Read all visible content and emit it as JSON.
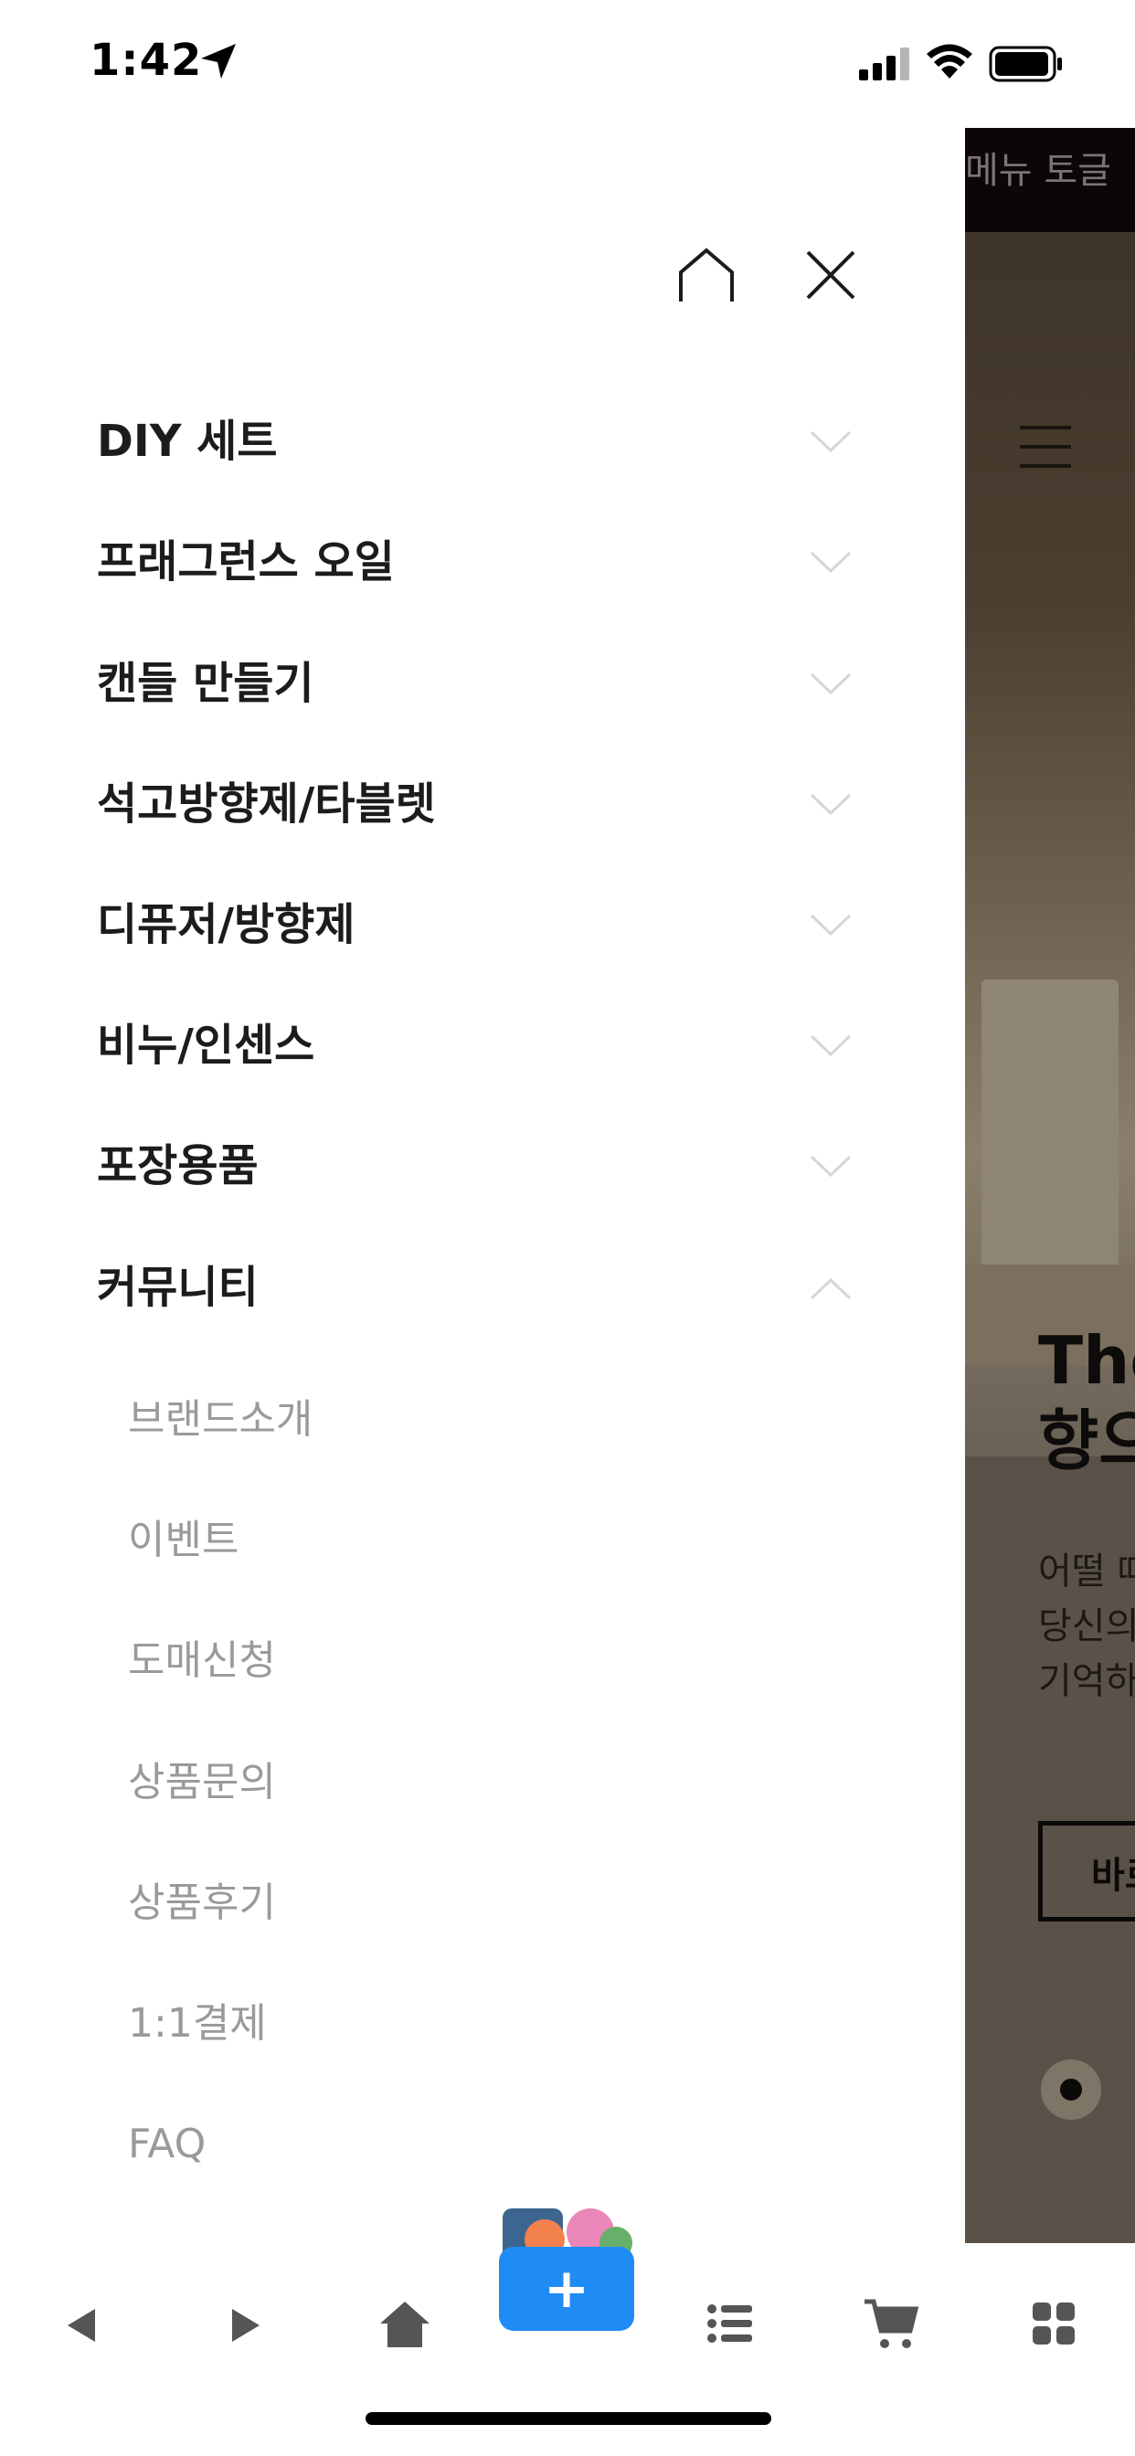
{
  "status_bar": {
    "time": "1:42"
  },
  "background_page": {
    "toggle_label": "메뉴 토글",
    "headline_line1": "The",
    "headline_line2": "향으",
    "body_line1": "어떨 때",
    "body_line2": "당신의",
    "body_line3": "기억하",
    "button_label": "바로"
  },
  "drawer": {
    "menu": [
      {
        "label": "DIY 세트",
        "expanded": false
      },
      {
        "label": "프래그런스 오일",
        "expanded": false
      },
      {
        "label": "캔들 만들기",
        "expanded": false
      },
      {
        "label": "석고방향제/타블렛",
        "expanded": false
      },
      {
        "label": "디퓨저/방향제",
        "expanded": false
      },
      {
        "label": "비누/인센스",
        "expanded": false
      },
      {
        "label": "포장용품",
        "expanded": false
      },
      {
        "label": "커뮤니티",
        "expanded": true
      }
    ],
    "community_submenu": [
      "브랜드소개",
      "이벤트",
      "도매신청",
      "상품문의",
      "상품후기",
      "1:1결제",
      "FAQ"
    ]
  },
  "toolbar": {
    "items": [
      "back-icon",
      "forward-icon",
      "home-icon",
      "add-icon",
      "list-icon",
      "cart-icon",
      "grid-icon"
    ],
    "fab_label": "+",
    "accent": "#1f8cf5"
  }
}
